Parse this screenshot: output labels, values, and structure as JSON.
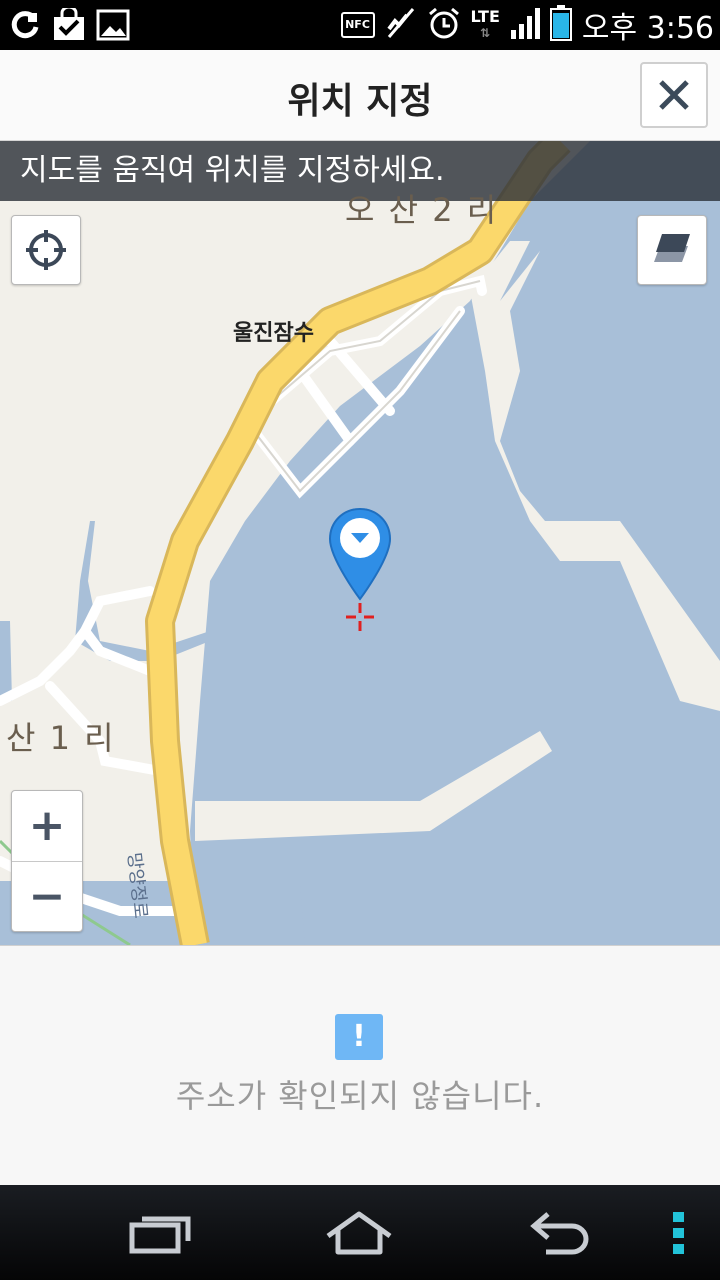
{
  "status_bar": {
    "time": "오후 3:56",
    "network": "LTE",
    "nfc_label": "NFC",
    "left_icons": [
      "olleh-icon",
      "shopping-bag-check-icon",
      "gallery-icon"
    ],
    "right_icons": [
      "nfc-icon",
      "mute-icon",
      "alarm-icon",
      "lte-icon",
      "signal-icon",
      "battery-icon"
    ]
  },
  "header": {
    "title": "위치 지정",
    "close_icon": "close-icon"
  },
  "map": {
    "hint": "지도를 움직여 위치를 지정하세요.",
    "place_labels": {
      "osan2ri": "오 산 2 리",
      "uljin_jamsu": "울진잠수",
      "san1ri": "산 1 리",
      "road": "망양정로"
    },
    "buttons": {
      "locate_icon": "crosshair-icon",
      "layers_icon": "layers-icon",
      "zoom_in": "+",
      "zoom_out": "−"
    },
    "colors": {
      "water": "#a8bfd8",
      "land": "#f2f0ea",
      "road_major": "#fbd86b",
      "road_minor": "#ffffff",
      "pin": "#2f8ee6",
      "target": "#e02020"
    }
  },
  "address": {
    "warning_symbol": "!",
    "message": "주소가 확인되지 않습니다."
  },
  "navbar": {
    "icons": [
      "recent-apps-icon",
      "home-icon",
      "back-icon",
      "menu-icon"
    ]
  }
}
